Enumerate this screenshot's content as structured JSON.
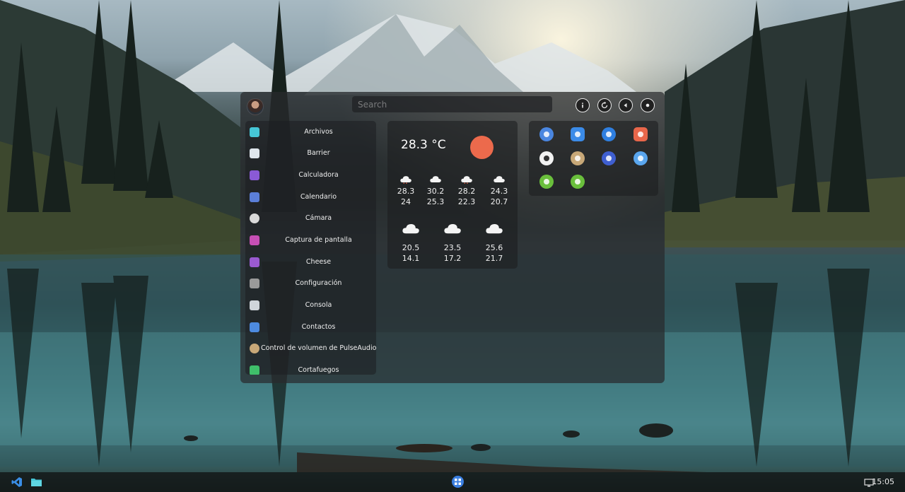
{
  "search": {
    "placeholder": "Search"
  },
  "power_buttons": [
    {
      "name": "info-button",
      "icon": "info-icon"
    },
    {
      "name": "restart-button",
      "icon": "restart-icon"
    },
    {
      "name": "logout-button",
      "icon": "back-icon"
    },
    {
      "name": "power-button",
      "icon": "power-icon"
    }
  ],
  "apps": [
    {
      "label": "Archivos",
      "icon": "folder-icon",
      "color": "#46c6d6"
    },
    {
      "label": "Barrier",
      "icon": "barrier-icon",
      "color": "#dfe6ec"
    },
    {
      "label": "Calculadora",
      "icon": "calculator-icon",
      "color": "#8a5ad6"
    },
    {
      "label": "Calendario",
      "icon": "calendar-icon",
      "color": "#5b7fd8"
    },
    {
      "label": "Cámara",
      "icon": "camera-icon",
      "color": "#d9d9d9"
    },
    {
      "label": "Captura de pantalla",
      "icon": "screenshot-icon",
      "color": "#c64fb4"
    },
    {
      "label": "Cheese",
      "icon": "cheese-icon",
      "color": "#9a5ad0"
    },
    {
      "label": "Configuración",
      "icon": "settings-icon",
      "color": "#9a9a9a"
    },
    {
      "label": "Consola",
      "icon": "terminal-icon",
      "color": "#cfd5da"
    },
    {
      "label": "Contactos",
      "icon": "contacts-icon",
      "color": "#4d8be0"
    },
    {
      "label": "Control de volumen de PulseAudio",
      "icon": "volume-icon",
      "color": "#c8a878"
    },
    {
      "label": "Cortafuegos",
      "icon": "firewall-icon",
      "color": "#3fbf6a"
    }
  ],
  "weather": {
    "current_temp": "28.3 °C",
    "sun_color": "#ec6a4c",
    "row1": [
      {
        "high": "28.3",
        "low": "24"
      },
      {
        "high": "30.2",
        "low": "25.3"
      },
      {
        "high": "28.2",
        "low": "22.3"
      },
      {
        "high": "24.3",
        "low": "20.7"
      }
    ],
    "row2": [
      {
        "high": "20.5",
        "low": "14.1"
      },
      {
        "high": "23.5",
        "low": "17.2"
      },
      {
        "high": "25.6",
        "low": "21.7"
      }
    ]
  },
  "favorites": [
    {
      "name": "fav-dev-tool",
      "icon": "compass-icon",
      "color": "#4a86e0"
    },
    {
      "name": "fav-app-grid",
      "icon": "app-grid-icon",
      "color": "#3b8be8"
    },
    {
      "name": "fav-hammer",
      "icon": "hammer-icon",
      "color": "#2f7fe0"
    },
    {
      "name": "fav-people",
      "icon": "people-icon",
      "color": "#e8664a"
    },
    {
      "name": "fav-paint",
      "icon": "brush-icon",
      "color": "#f2f2f2"
    },
    {
      "name": "fav-audio",
      "icon": "speaker-icon",
      "color": "#c8a878"
    },
    {
      "name": "fav-browser",
      "icon": "globe-icon",
      "color": "#3f5fd0"
    },
    {
      "name": "fav-disk",
      "icon": "disk-icon",
      "color": "#5aa6ee"
    },
    {
      "name": "fav-settings-1",
      "icon": "gear-icon",
      "color": "#6abf3c"
    },
    {
      "name": "fav-settings-2",
      "icon": "gear-icon",
      "color": "#6abf3c"
    }
  ],
  "taskbar": {
    "apps": [
      {
        "name": "vscode",
        "icon": "vscode-icon",
        "color": "#3a8ee6"
      },
      {
        "name": "files",
        "icon": "folder-icon",
        "color": "#46c6d6"
      }
    ],
    "launcher_icon": "app-grid-icon",
    "clock": "15:05"
  }
}
